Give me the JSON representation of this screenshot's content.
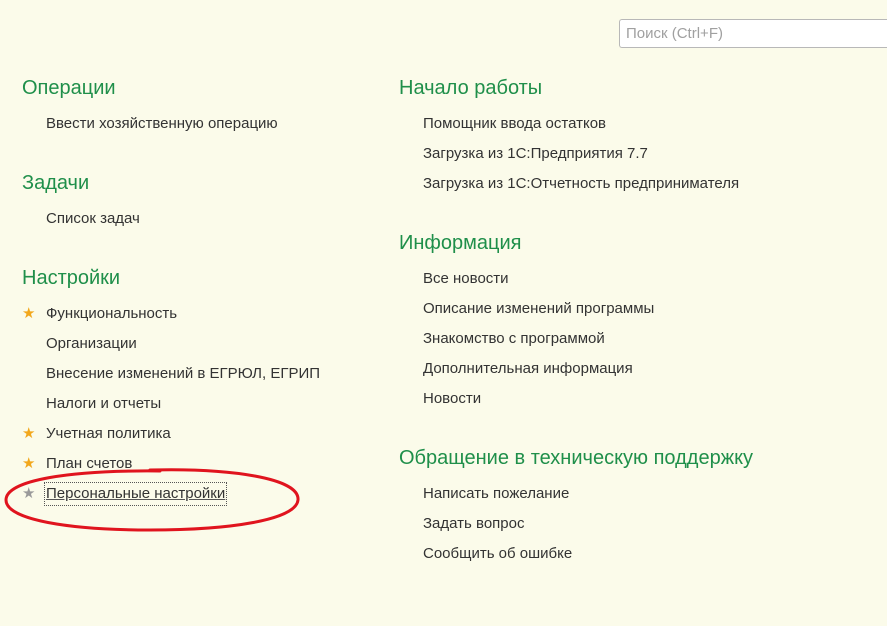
{
  "search": {
    "placeholder": "Поиск (Ctrl+F)",
    "value": ""
  },
  "left": {
    "operations": {
      "title": "Операции",
      "items": [
        "Ввести хозяйственную операцию"
      ]
    },
    "tasks": {
      "title": "Задачи",
      "items": [
        "Список задач"
      ]
    },
    "settings": {
      "title": "Настройки",
      "items": [
        {
          "label": "Функциональность",
          "favorite": true
        },
        {
          "label": "Организации",
          "favorite": false
        },
        {
          "label": "Внесение изменений в ЕГРЮЛ, ЕГРИП",
          "favorite": false
        },
        {
          "label": "Налоги и отчеты",
          "favorite": false
        },
        {
          "label": "Учетная политика",
          "favorite": true
        },
        {
          "label": "План счетов",
          "favorite": true
        },
        {
          "label": "Персональные настройки",
          "favorite": false,
          "selected": true
        }
      ]
    }
  },
  "right": {
    "getting_started": {
      "title": "Начало работы",
      "items": [
        "Помощник ввода остатков",
        "Загрузка из 1С:Предприятия 7.7",
        "Загрузка из 1С:Отчетность предпринимателя"
      ]
    },
    "information": {
      "title": "Информация",
      "items": [
        "Все новости",
        "Описание изменений программы",
        "Знакомство с программой",
        "Дополнительная информация",
        "Новости"
      ]
    },
    "support": {
      "title": "Обращение в техническую поддержку",
      "items": [
        "Написать пожелание",
        "Задать вопрос",
        "Сообщить об ошибке"
      ]
    }
  },
  "colors": {
    "background": "#fbfbea",
    "section_title": "#1f8f4a",
    "favorite_star": "#f2a71b",
    "annotation_ellipse": "#e0141e"
  }
}
